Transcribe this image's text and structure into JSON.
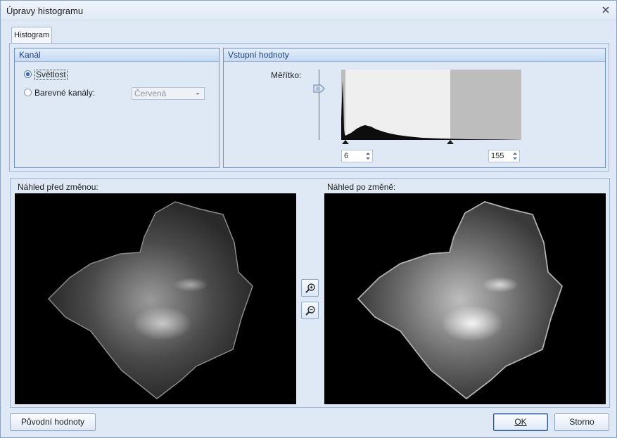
{
  "window": {
    "title": "Úpravy histogramu",
    "close_icon": "close-icon"
  },
  "tabs": [
    {
      "label": "Histogram",
      "selected": true
    }
  ],
  "kanal": {
    "header": "Kanál",
    "options": [
      {
        "label": "Světlost",
        "checked": true
      },
      {
        "label": "Barevné kanály:",
        "checked": false
      }
    ],
    "channel_select": {
      "value": "Červená",
      "enabled": false
    }
  },
  "vstup": {
    "header": "Vstupní hodnoty",
    "scale_label": "Měřítko:",
    "scale_level": 0.28,
    "min_value": "6",
    "max_value": "155",
    "histogram_range": [
      0,
      255
    ]
  },
  "preview": {
    "before_label": "Náhled před změnou:",
    "after_label": "Náhled po změně:",
    "zoom_in_icon": "zoom-in-icon",
    "zoom_out_icon": "zoom-out-icon"
  },
  "buttons": {
    "reset": "Původní hodnoty",
    "ok": "OK",
    "cancel": "Storno"
  }
}
